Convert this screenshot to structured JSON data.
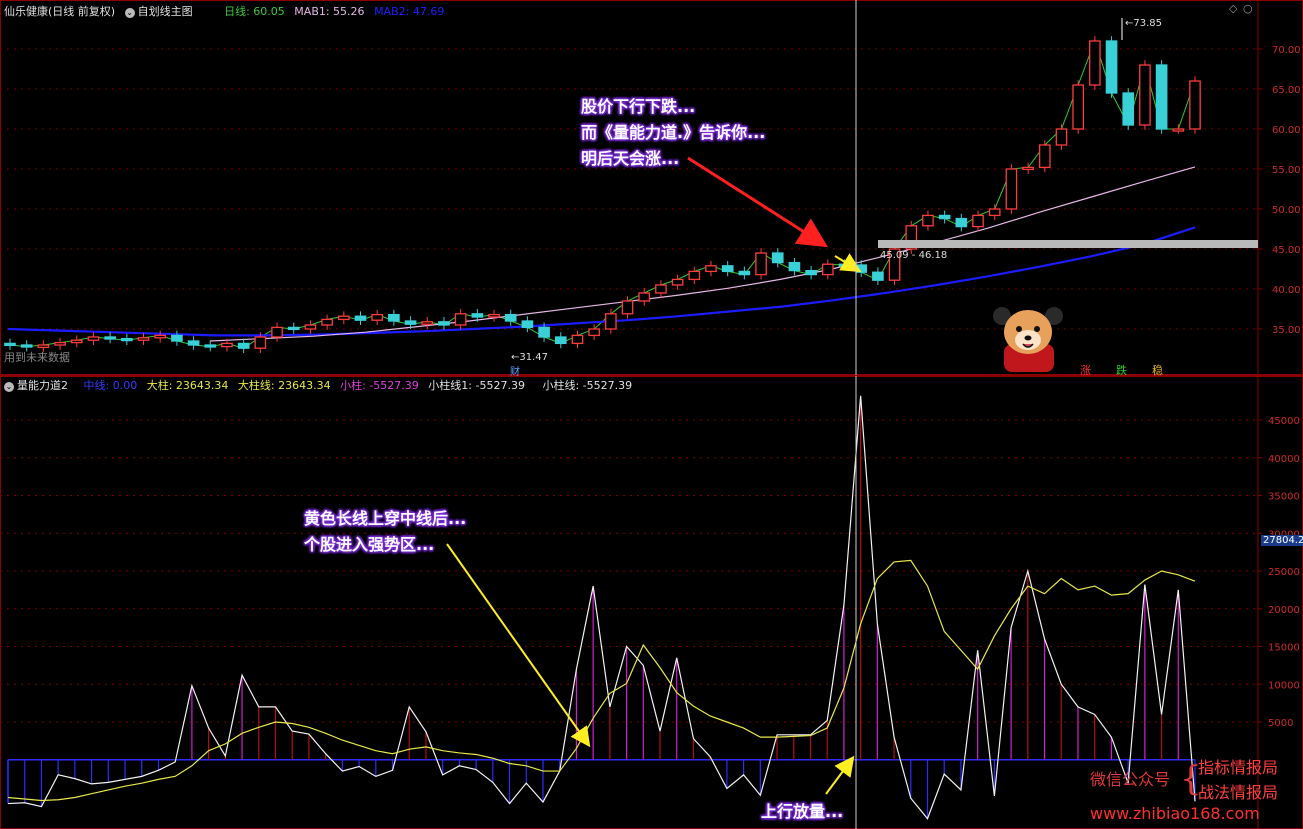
{
  "main_header": {
    "stock": "仙乐健康(日线 前复权)",
    "formula": "自划线主图",
    "ma_day": "日线: 60.05",
    "mab1": "MAB1: 55.26",
    "mab2": "MAB2: 47.69"
  },
  "main_axis": [
    "70.00",
    "65.00",
    "60.00",
    "55.00",
    "50.00",
    "45.00",
    "40.00",
    "35.00"
  ],
  "main_labels": {
    "high": "73.85",
    "low": "31.47",
    "range": "45.09 - 46.18",
    "future": "用到未来数据",
    "cai": "财",
    "zhang": "涨",
    "die": "跌",
    "wen": "稳"
  },
  "ind_header": {
    "name": "量能力道2",
    "mid": "中线: 0.00",
    "big": "大柱: 23643.34",
    "bigline": "大柱线: 23643.34",
    "small": "小柱: -5527.39",
    "smallline1": "小柱线1: -5527.39",
    "smallline": "小柱线: -5527.39"
  },
  "ind_axis": [
    "45000",
    "40000",
    "35000",
    "30000",
    "25000",
    "20000",
    "15000",
    "10000",
    "5000"
  ],
  "ind_cursor_value": "27804.24",
  "callouts": {
    "top": [
      "股价下行下跌...",
      "而《量能力道.》告诉你...",
      "明后天会涨..."
    ],
    "mid": [
      "黄色长线上穿中线后...",
      "个股进入强势区..."
    ],
    "bottom": "上行放量..."
  },
  "watermark": {
    "wechat": "微信公众号",
    "name1": "指标情报局",
    "name2": "战法情报局",
    "url": "www.zhibiao168.com"
  },
  "chart_data": {
    "type": "candlestick",
    "ylim": [
      31,
      74
    ],
    "candles": [
      {
        "o": 33.2,
        "c": 33.0
      },
      {
        "o": 33.0,
        "c": 32.8
      },
      {
        "o": 32.7,
        "c": 33.0
      },
      {
        "o": 33.0,
        "c": 33.3
      },
      {
        "o": 33.3,
        "c": 33.6
      },
      {
        "o": 33.6,
        "c": 34.0
      },
      {
        "o": 34.0,
        "c": 33.8
      },
      {
        "o": 33.8,
        "c": 33.6
      },
      {
        "o": 33.6,
        "c": 33.9
      },
      {
        "o": 33.9,
        "c": 34.2
      },
      {
        "o": 34.2,
        "c": 33.5
      },
      {
        "o": 33.5,
        "c": 33.0
      },
      {
        "o": 33.0,
        "c": 32.8
      },
      {
        "o": 32.8,
        "c": 33.2
      },
      {
        "o": 33.2,
        "c": 32.6
      },
      {
        "o": 32.6,
        "c": 34.0
      },
      {
        "o": 34.0,
        "c": 35.2
      },
      {
        "o": 35.2,
        "c": 35.0
      },
      {
        "o": 35.0,
        "c": 35.5
      },
      {
        "o": 35.5,
        "c": 36.2
      },
      {
        "o": 36.2,
        "c": 36.6
      },
      {
        "o": 36.6,
        "c": 36.1
      },
      {
        "o": 36.1,
        "c": 36.8
      },
      {
        "o": 36.8,
        "c": 36.0
      },
      {
        "o": 36.0,
        "c": 35.6
      },
      {
        "o": 35.6,
        "c": 35.9
      },
      {
        "o": 35.9,
        "c": 35.5
      },
      {
        "o": 35.5,
        "c": 36.9
      },
      {
        "o": 36.9,
        "c": 36.5
      },
      {
        "o": 36.5,
        "c": 36.8
      },
      {
        "o": 36.8,
        "c": 36.0
      },
      {
        "o": 36.0,
        "c": 35.2
      },
      {
        "o": 35.2,
        "c": 34.0
      },
      {
        "o": 34.0,
        "c": 33.2
      },
      {
        "o": 33.2,
        "c": 34.2
      },
      {
        "o": 34.2,
        "c": 35.0
      },
      {
        "o": 35.0,
        "c": 36.9
      },
      {
        "o": 36.9,
        "c": 38.5
      },
      {
        "o": 38.5,
        "c": 39.5
      },
      {
        "o": 39.5,
        "c": 40.5
      },
      {
        "o": 40.5,
        "c": 41.2
      },
      {
        "o": 41.2,
        "c": 42.2
      },
      {
        "o": 42.2,
        "c": 42.9
      },
      {
        "o": 42.9,
        "c": 42.2
      },
      {
        "o": 42.2,
        "c": 41.8
      },
      {
        "o": 41.8,
        "c": 44.5
      },
      {
        "o": 44.5,
        "c": 43.3
      },
      {
        "o": 43.3,
        "c": 42.3
      },
      {
        "o": 42.3,
        "c": 41.8
      },
      {
        "o": 41.8,
        "c": 43.1
      },
      {
        "o": 43.1,
        "c": 43.0
      },
      {
        "o": 43.0,
        "c": 42.1
      },
      {
        "o": 42.1,
        "c": 41.1
      },
      {
        "o": 41.1,
        "c": 45.0
      },
      {
        "o": 45.0,
        "c": 47.9
      },
      {
        "o": 47.9,
        "c": 49.2
      },
      {
        "o": 49.2,
        "c": 48.8
      },
      {
        "o": 48.8,
        "c": 47.8
      },
      {
        "o": 47.8,
        "c": 49.2
      },
      {
        "o": 49.2,
        "c": 50.0
      },
      {
        "o": 50.0,
        "c": 55.0
      },
      {
        "o": 55.0,
        "c": 55.2
      },
      {
        "o": 55.2,
        "c": 58.0
      },
      {
        "o": 58.0,
        "c": 60.0
      },
      {
        "o": 60.0,
        "c": 65.5
      },
      {
        "o": 65.5,
        "c": 71.0
      },
      {
        "o": 71.0,
        "c": 64.5
      },
      {
        "o": 64.5,
        "c": 60.5
      },
      {
        "o": 60.5,
        "c": 68.0
      },
      {
        "o": 68.0,
        "c": 60.0
      },
      {
        "o": 60.0,
        "c": 60.0
      },
      {
        "o": 60.0,
        "c": 66.0
      }
    ],
    "mab1": [
      34.4,
      34.3,
      34.2,
      34.0,
      33.9,
      33.8,
      33.7,
      33.6,
      33.5,
      33.5,
      33.5,
      33.6,
      33.8,
      34.0,
      34.3,
      34.7,
      35.1,
      35.6,
      36.1,
      36.7,
      37.4,
      38.1,
      38.9,
      39.6,
      40.3,
      41.2,
      42.2,
      43.3,
      44.5,
      45.9,
      47.4,
      49.0,
      50.7,
      52.4,
      53.9,
      55.3
    ],
    "mab2": [
      34.9,
      34.6,
      34.3,
      34.1,
      34.0,
      34.0,
      34.1,
      34.2,
      34.3,
      34.5,
      34.7,
      35.0,
      35.3,
      35.6,
      35.9,
      36.3,
      36.8,
      37.4,
      38.0,
      38.6,
      39.3,
      40.1,
      40.9,
      41.7,
      42.6,
      43.5,
      44.4,
      45.4,
      46.5,
      47.7
    ],
    "ind_ylim": [
      -8000,
      49000
    ],
    "bars": [
      -5800,
      -5700,
      -6200,
      -2000,
      -2500,
      -3200,
      -3000,
      -2600,
      -2200,
      -1400,
      -300,
      9800,
      4200,
      500,
      11200,
      7000,
      7000,
      3800,
      3400,
      800,
      -1500,
      -900,
      -2200,
      -1400,
      7000,
      3700,
      -2000,
      -800,
      -1300,
      -3000,
      -5800,
      -3100,
      -5600,
      -1500,
      12000,
      23000,
      7000,
      15000,
      12500,
      3800,
      13500,
      2800,
      400,
      -3800,
      -2000,
      -4700,
      3300,
      3300,
      3300,
      5200,
      20500,
      48200,
      18000,
      3000,
      -5100,
      -7800,
      -1900,
      -4000,
      14500,
      -4800,
      17500,
      25000,
      16000,
      10000,
      7000,
      6000,
      3000,
      -3100,
      23200,
      6000,
      22500,
      -5500
    ],
    "bigline": [
      -5000,
      -5200,
      -5400,
      -5300,
      -5000,
      -4500,
      -4000,
      -3500,
      -3100,
      -2600,
      -2200,
      -800,
      1200,
      2100,
      3500,
      4300,
      5000,
      4800,
      4300,
      3500,
      2600,
      1900,
      1200,
      800,
      1400,
      1700,
      1200,
      900,
      700,
      200,
      -500,
      -800,
      -1500,
      -1500,
      1500,
      5500,
      8800,
      10100,
      15200,
      12200,
      8900,
      7100,
      5800,
      5000,
      4200,
      3000,
      3000,
      3100,
      3200,
      4200,
      9500,
      18000,
      24000,
      26200,
      26400,
      23000,
      17000,
      14500,
      12000,
      16400,
      20000,
      23000,
      22000,
      24000,
      22500,
      23000,
      21800,
      22000,
      23800,
      25000,
      24500,
      23643
    ]
  }
}
